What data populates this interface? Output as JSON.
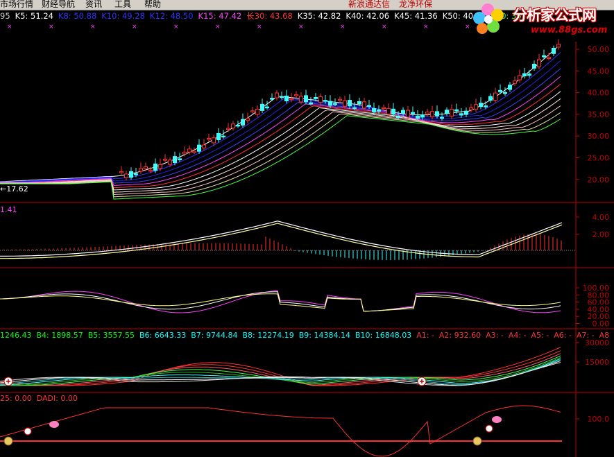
{
  "menu": {
    "items": [
      "市场行情",
      "财经导航",
      "资讯",
      "工具",
      "帮助"
    ],
    "right_links": [
      "新浪通达信",
      "龙净环保"
    ]
  },
  "ma_bar": [
    {
      "text": "95",
      "color": "#cccccc"
    },
    {
      "text": "K5: 51.24",
      "color": "#ffffff"
    },
    {
      "text": "K8: 50.88",
      "color": "#3030ff"
    },
    {
      "text": "K10: 49.28",
      "color": "#3030ff"
    },
    {
      "text": "K12: 48.50",
      "color": "#3030ff"
    },
    {
      "text": "K15: 47.42",
      "color": "#ff40ff"
    },
    {
      "text": "长30: 43.68",
      "color": "#ff3030"
    },
    {
      "text": "K35: 42.82",
      "color": "#ffffff"
    },
    {
      "text": "K40: 42.06",
      "color": "#ffffff"
    },
    {
      "text": "K45: 41.36",
      "color": "#ffffff"
    },
    {
      "text": "K50: 40.72",
      "color": "#ffffff"
    },
    {
      "text": "K60: 30",
      "color": "#30ff30"
    }
  ],
  "logo": {
    "title": "分析家公式网",
    "url": "www.88gs.com"
  },
  "main_chart": {
    "y_ticks": [
      "50.00",
      "45.00",
      "40.00",
      "35.00",
      "30.00",
      "25.00",
      "20.00"
    ],
    "low_marker": "←17.62"
  },
  "macd": {
    "label": "1.41",
    "y_ticks": [
      "4.00",
      "2.00"
    ]
  },
  "kdj": {
    "y_ticks": [
      "100.00",
      "80.00",
      "60.00",
      "40.00",
      "20.00",
      "0.00"
    ]
  },
  "wave": {
    "label_items": [
      {
        "text": "1246.43",
        "color": "#00ff00"
      },
      {
        "text": "B4: 1898.57",
        "color": "#00ff00"
      },
      {
        "text": "B5: 3557.55",
        "color": "#00ff00"
      },
      {
        "text": "B6: 6643.33",
        "color": "#00ffff"
      },
      {
        "text": "B7: 9744.84",
        "color": "#00ffff"
      },
      {
        "text": "B8: 12274.19",
        "color": "#00ffff"
      },
      {
        "text": "B9: 14384.14",
        "color": "#00ffff"
      },
      {
        "text": "B10: 16848.03",
        "color": "#00ffff"
      },
      {
        "text": "A1: -",
        "color": "#ff3030"
      },
      {
        "text": "A2: 932.60",
        "color": "#ff3030"
      },
      {
        "text": "A3: -",
        "color": "#ff3030"
      },
      {
        "text": "A4: -",
        "color": "#ff3030"
      },
      {
        "text": "A5: -",
        "color": "#ff3030"
      },
      {
        "text": "A6: -",
        "color": "#ff3030"
      },
      {
        "text": "A7: -",
        "color": "#ff3030"
      },
      {
        "text": "A8",
        "color": "#ff3030"
      }
    ],
    "y_ticks": [
      "30000",
      "15000"
    ]
  },
  "dadi": {
    "label_items": [
      {
        "text": "25: 0.00",
        "color": "#ff3030"
      },
      {
        "text": "DADI: 0.00",
        "color": "#ff3030"
      }
    ],
    "y_ticks": [
      "100.0"
    ]
  }
}
